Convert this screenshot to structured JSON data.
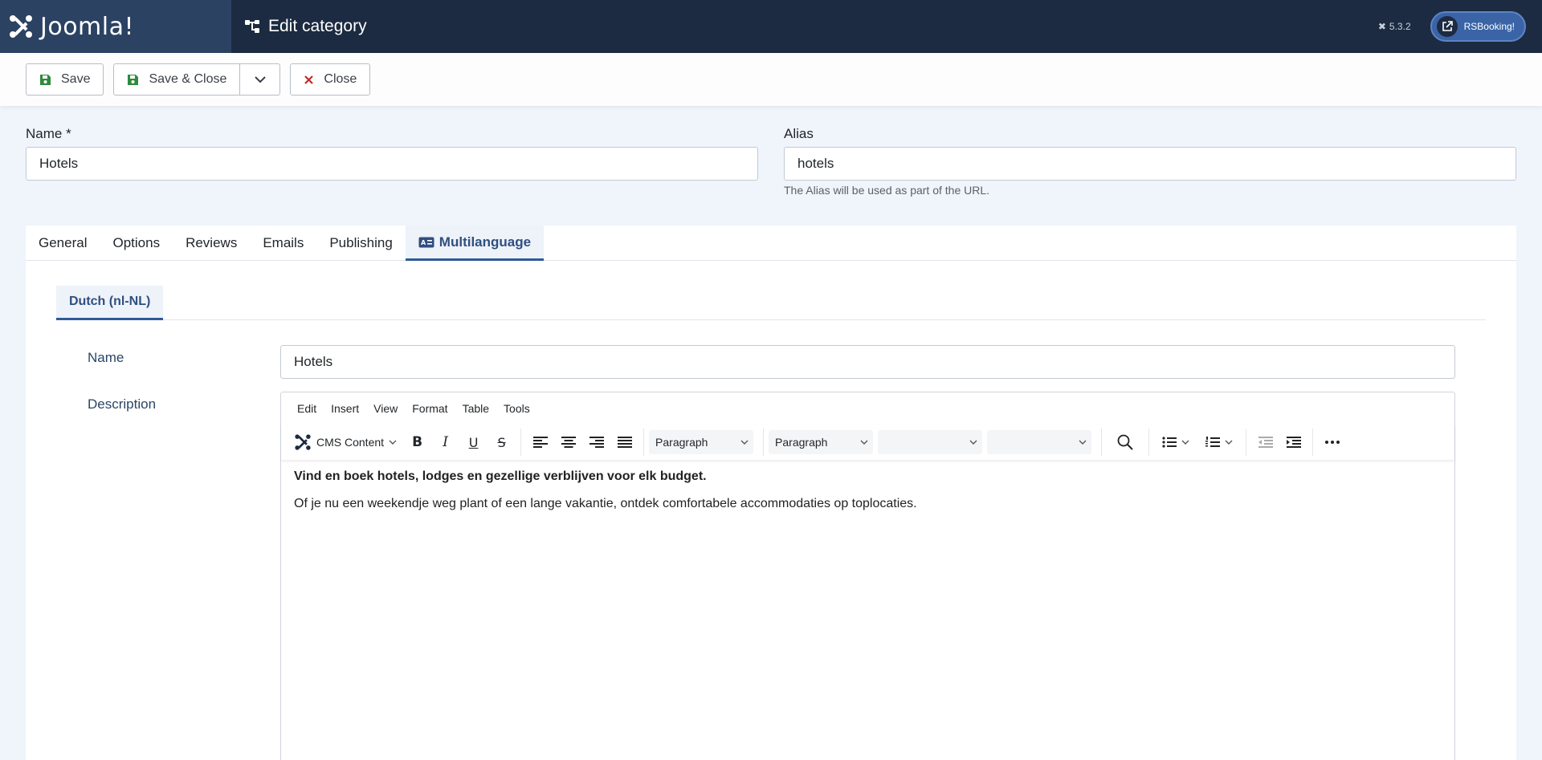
{
  "header": {
    "logo_text": "Joomla!",
    "page_title": "Edit category",
    "version": "5.3.2",
    "user_button": "RSBooking!"
  },
  "toolbar": {
    "save": "Save",
    "save_close": "Save & Close",
    "close": "Close"
  },
  "fields": {
    "name_label": "Name *",
    "name_value": "Hotels",
    "alias_label": "Alias",
    "alias_value": "hotels",
    "alias_hint": "The Alias will be used as part of the URL."
  },
  "tabs": [
    "General",
    "Options",
    "Reviews",
    "Emails",
    "Publishing",
    "Multilanguage"
  ],
  "active_tab": "Multilanguage",
  "subtab": "Dutch (nl-NL)",
  "multilanguage": {
    "name_label": "Name",
    "name_value": "Hotels",
    "description_label": "Description"
  },
  "editor": {
    "menu": [
      "Edit",
      "Insert",
      "View",
      "Format",
      "Table",
      "Tools"
    ],
    "cms_content": "CMS Content",
    "block_select_1": "Paragraph",
    "block_select_2": "Paragraph",
    "line1": "Vind en boek hotels, lodges en gezellige verblijven voor elk budget.",
    "line2": "Of je nu een weekendje weg plant of een lange vakantie, ontdek comfortabele accommodaties op toplocaties."
  },
  "colors": {
    "header_bg": "#1c2b41",
    "logo_bg": "#2b4263",
    "accent": "#2f5a96",
    "save_green": "#2e8a3c",
    "close_red": "#c52827"
  }
}
